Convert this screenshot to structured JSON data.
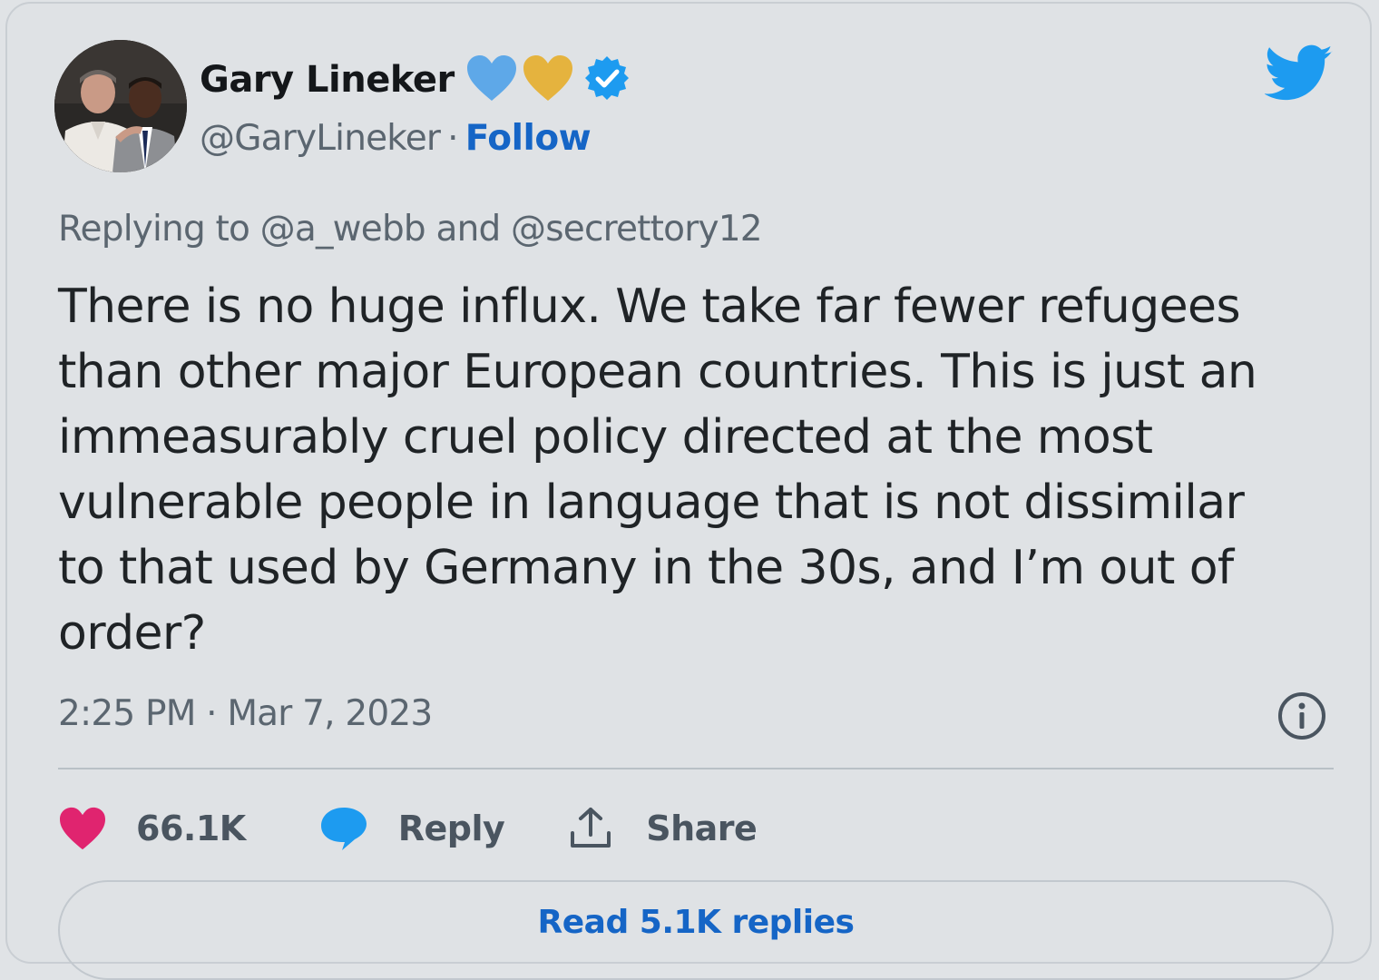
{
  "author": {
    "name": "Gary Lineker",
    "name_emojis": [
      "blue-heart-icon",
      "yellow-heart-icon"
    ],
    "verified_icon": "verified-badge-icon",
    "handle": "@GaryLineker",
    "separator": "·",
    "follow_label": "Follow",
    "avatar_icon": "avatar-photo"
  },
  "platform_icon": "twitter-bird-icon",
  "reply_context": "Replying to @a_webb and @secrettory12",
  "tweet_text": "There is no huge influx. We take far fewer refugees\nthan other major European countries. This is just an\nimmeasurably cruel policy directed at the most\nvulnerable people in language that is not dissimilar\nto that used by Germany in the 30s, and I’m out of\norder?",
  "timestamp": "2:25 PM · Mar 7, 2023",
  "info_icon": "info-icon",
  "actions": {
    "like_count": "66.1K",
    "reply_label": "Reply",
    "share_label": "Share"
  },
  "read_replies_label": "Read 5.1K replies",
  "colors": {
    "accent": "#1565c6",
    "like": "#e0246f",
    "reply_bubble": "#1d9bf0",
    "twitter_blue": "#1d9bf0",
    "verified": "#1d9bf0",
    "background": "#dfe2e5"
  }
}
